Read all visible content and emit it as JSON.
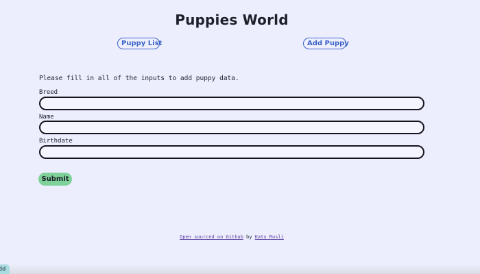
{
  "header": {
    "title": "Puppies World"
  },
  "nav": {
    "puppy_list_label": "Puppy List",
    "add_puppy_label": "Add Puppy"
  },
  "form": {
    "instructions": "Please fill in all of the inputs to add puppy data.",
    "fields": [
      {
        "label": "Breed",
        "value": "",
        "placeholder": ""
      },
      {
        "label": "Name",
        "value": "",
        "placeholder": ""
      },
      {
        "label": "Birthdate",
        "value": "",
        "placeholder": ""
      }
    ],
    "submit_label": "Submit"
  },
  "footer": {
    "link_text": "Open sourced on Github",
    "by_text": " by ",
    "author_text": "Katy Rosli"
  },
  "corner_tab": {
    "label": "dd"
  },
  "colors": {
    "background": "#eceefd",
    "accent": "#3b63c7",
    "submit": "#7fd19a",
    "link": "#5a3fa0"
  }
}
